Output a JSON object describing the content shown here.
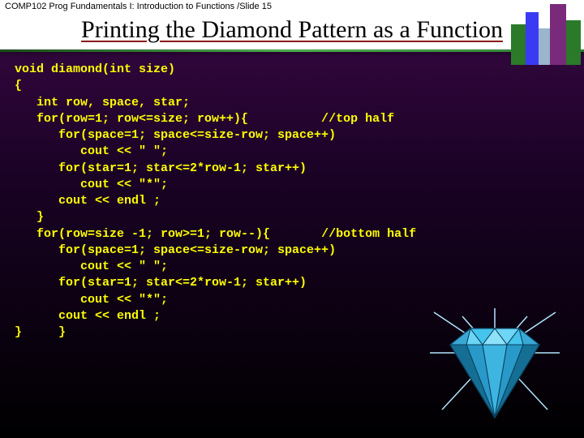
{
  "header": "COMP102 Prog Fundamentals I: Introduction to Functions /Slide 15",
  "title": "Printing the Diamond Pattern as a Function",
  "code": {
    "l1": "void diamond(int size)",
    "l2": "{",
    "l3": "   int row, space, star;",
    "l4a": "   for(row=1; row<=size; row++){",
    "l4b": "          //top half",
    "l5": "      for(space=1; space<=size-row; space++)",
    "l6": "         cout << \" \";",
    "l7": "      for(star=1; star<=2*row-1; star++)",
    "l8": "         cout << \"*\";",
    "l9": "      cout << endl ;",
    "l10": "   }",
    "l11a": "   for(row=size -1; row>=1; row--){",
    "l11b": "       //bottom half",
    "l12": "      for(space=1; space<=size-row; space++)",
    "l13": "         cout << \" \";",
    "l14": "      for(star=1; star<=2*row-1; star++)",
    "l15": "         cout << \"*\";",
    "l16": "      cout << endl ;",
    "l17": "}     }"
  }
}
